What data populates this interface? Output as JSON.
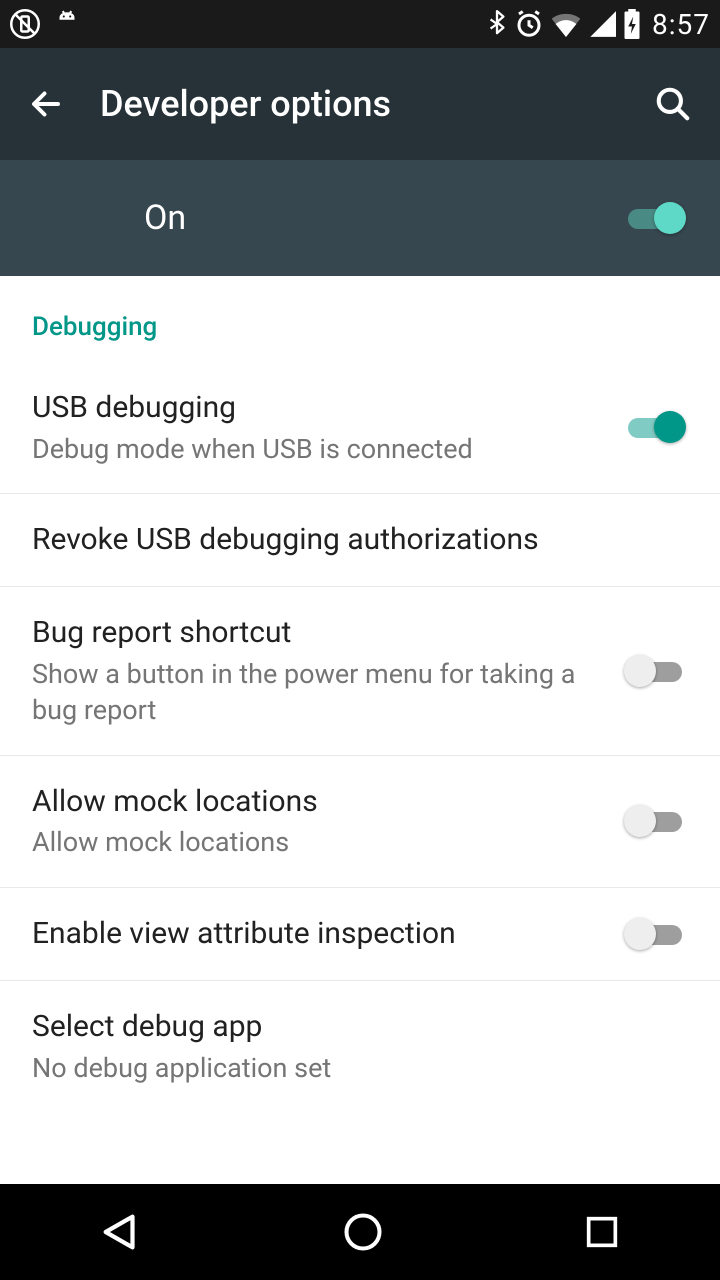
{
  "status": {
    "time": "8:57"
  },
  "appbar": {
    "title": "Developer options"
  },
  "master": {
    "label": "On",
    "on": true
  },
  "section": {
    "header": "Debugging"
  },
  "settings": {
    "usb_debug": {
      "title": "USB debugging",
      "sub": "Debug mode when USB is connected",
      "on": true
    },
    "revoke": {
      "title": "Revoke USB debugging authorizations"
    },
    "bug_report": {
      "title": "Bug report shortcut",
      "sub": "Show a button in the power menu for taking a bug report",
      "on": false
    },
    "mock_loc": {
      "title": "Allow mock locations",
      "sub": "Allow mock locations",
      "on": false
    },
    "view_attr": {
      "title": "Enable view attribute inspection",
      "on": false
    },
    "debug_app": {
      "title": "Select debug app",
      "sub": "No debug application set"
    }
  }
}
